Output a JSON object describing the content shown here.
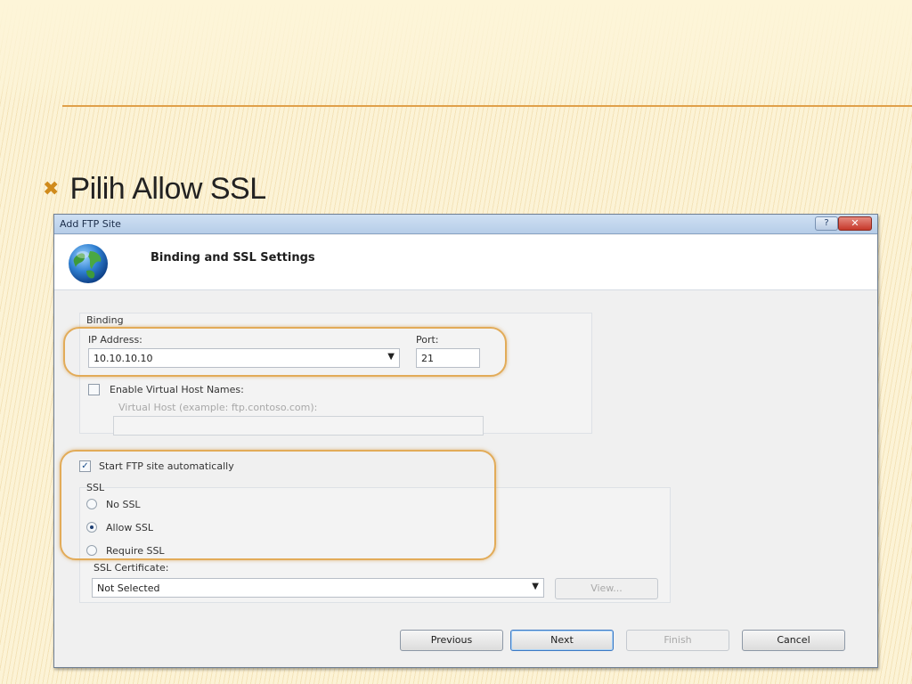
{
  "slide": {
    "bullet_prefix": "Pilih",
    "bullet_emphasis": "Allow SSL",
    "colors": {
      "background": "#fcf3d6",
      "rule": "#e0a04a",
      "bullet": "#d08b1c",
      "highlight": "#e2ab58"
    }
  },
  "dialog": {
    "window_title": "Add FTP Site",
    "help_glyph": "?",
    "close_glyph": "✕",
    "page_title": "Binding and SSL Settings",
    "binding": {
      "group_label": "Binding",
      "ip_label": "IP Address:",
      "ip_value": "10.10.10.10",
      "port_label": "Port:",
      "port_value": "21",
      "virtual_host_checkbox_label": "Enable Virtual Host Names:",
      "virtual_host_checked": false,
      "virtual_host_label": "Virtual Host (example: ftp.contoso.com):",
      "virtual_host_value": ""
    },
    "start_auto": {
      "label": "Start FTP site automatically",
      "checked": true
    },
    "ssl": {
      "group_label": "SSL",
      "options": [
        {
          "label": "No SSL",
          "selected": false
        },
        {
          "label": "Allow SSL",
          "selected": true
        },
        {
          "label": "Require SSL",
          "selected": false
        }
      ],
      "certificate_label": "SSL Certificate:",
      "certificate_value": "Not Selected",
      "view_button": "View..."
    },
    "buttons": {
      "previous": "Previous",
      "next": "Next",
      "finish": "Finish",
      "cancel": "Cancel"
    }
  }
}
